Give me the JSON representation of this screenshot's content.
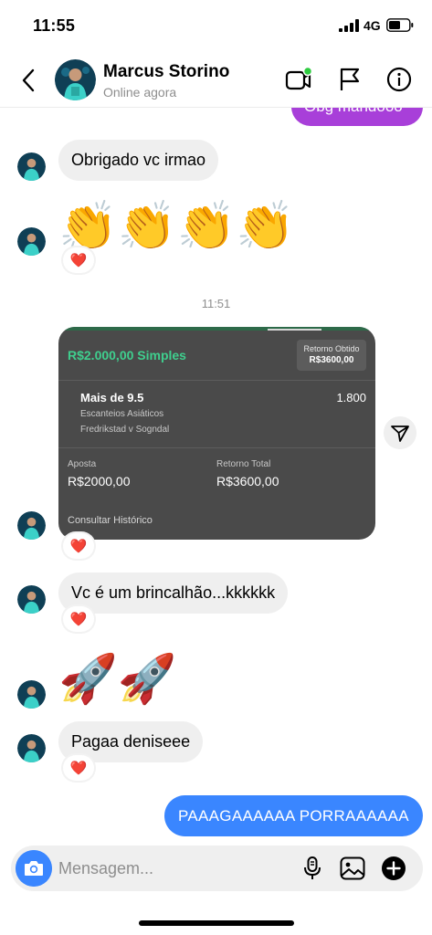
{
  "status_bar": {
    "time": "11:55",
    "network": "4G"
  },
  "header": {
    "contact_name": "Marcus Storino",
    "contact_status": "Online agora",
    "icons": [
      "back-icon",
      "video-call-icon",
      "flag-icon",
      "info-icon"
    ]
  },
  "messages": {
    "outgoing_top": "Obg mandooo",
    "obrigado": "Obrigado vc irmao",
    "clap_emojis": "👏👏👏👏",
    "timestamp": "11:51",
    "brincalhao": "Vc é um brincalhão...kkkkkk",
    "rocket_emojis": "🚀🚀",
    "pagaa": "Pagaa deniseee",
    "outgoing_bottom": "PAAAGAAAAAA PORRAAAAAA",
    "reaction": "❤️"
  },
  "bet_card": {
    "stake_title": "R$2.000,00 Simples",
    "return_label": "Retorno Obtido",
    "return_value": "R$3600,00",
    "selection": "Mais de 9.5",
    "odds": "1.800",
    "market": "Escanteios Asiáticos",
    "event": "Fredrikstad v Sogndal",
    "stake_label": "Aposta",
    "stake_value": "R$2000,00",
    "total_return_label": "Retorno Total",
    "total_return_value": "R$3600,00",
    "history_link": "Consultar Histórico"
  },
  "composer": {
    "placeholder": "Mensagem...",
    "icons": [
      "camera-icon",
      "microphone-icon",
      "gallery-icon",
      "add-icon"
    ]
  },
  "colors": {
    "outgoing_bubble": "#3a86ff",
    "outgoing_purple": "#a83fd9",
    "incoming_bubble": "#efefef",
    "bet_card_bg": "#4a4a4a",
    "bet_accent_green": "#3fcf8e",
    "online_dot": "#2ecc40"
  }
}
